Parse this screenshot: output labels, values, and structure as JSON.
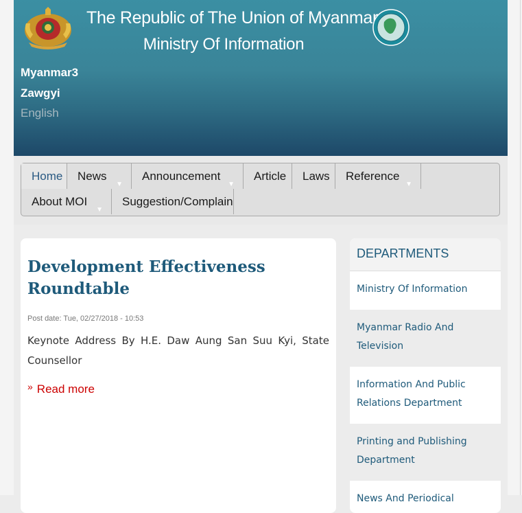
{
  "header": {
    "title_line1": "The Republic of The Union of Myanmar",
    "title_line2": "Ministry Of Information",
    "emblem_icon": "state-seal-icon",
    "globe_icon": "ministry-logo-icon",
    "languages": [
      "Myanmar3",
      "Zawgyi",
      "English"
    ],
    "active_language": "English"
  },
  "nav": {
    "items": [
      {
        "label": "Home"
      },
      {
        "label": "News"
      },
      {
        "label": "Announcement"
      },
      {
        "label": "Article"
      },
      {
        "label": "Laws"
      },
      {
        "label": "Reference"
      },
      {
        "label": "About MOI"
      },
      {
        "label": "Suggestion/Complain"
      }
    ]
  },
  "article": {
    "title": "Development Effectiveness Roundtable",
    "post_date": "Post date: Tue, 02/27/2018 - 10:53",
    "body": "Keynote Address By H.E. Daw Aung San Suu Kyi, State Counsellor",
    "read_more": "Read more",
    "read_more_icon": "double-chevron-right-icon"
  },
  "sidebar": {
    "heading": "DEPARTMENTS",
    "items": [
      {
        "label": "Ministry Of Information"
      },
      {
        "label": "Myanmar Radio And Television"
      },
      {
        "label": "Information And Public Relations Department"
      },
      {
        "label": "Printing and Publishing Department"
      },
      {
        "label": "News And Periodical"
      }
    ]
  },
  "colors": {
    "header_top": "#3b8fa3",
    "header_bottom": "#1d4868",
    "link_blue": "#1e5a7a",
    "read_more_red": "#cc0000"
  }
}
